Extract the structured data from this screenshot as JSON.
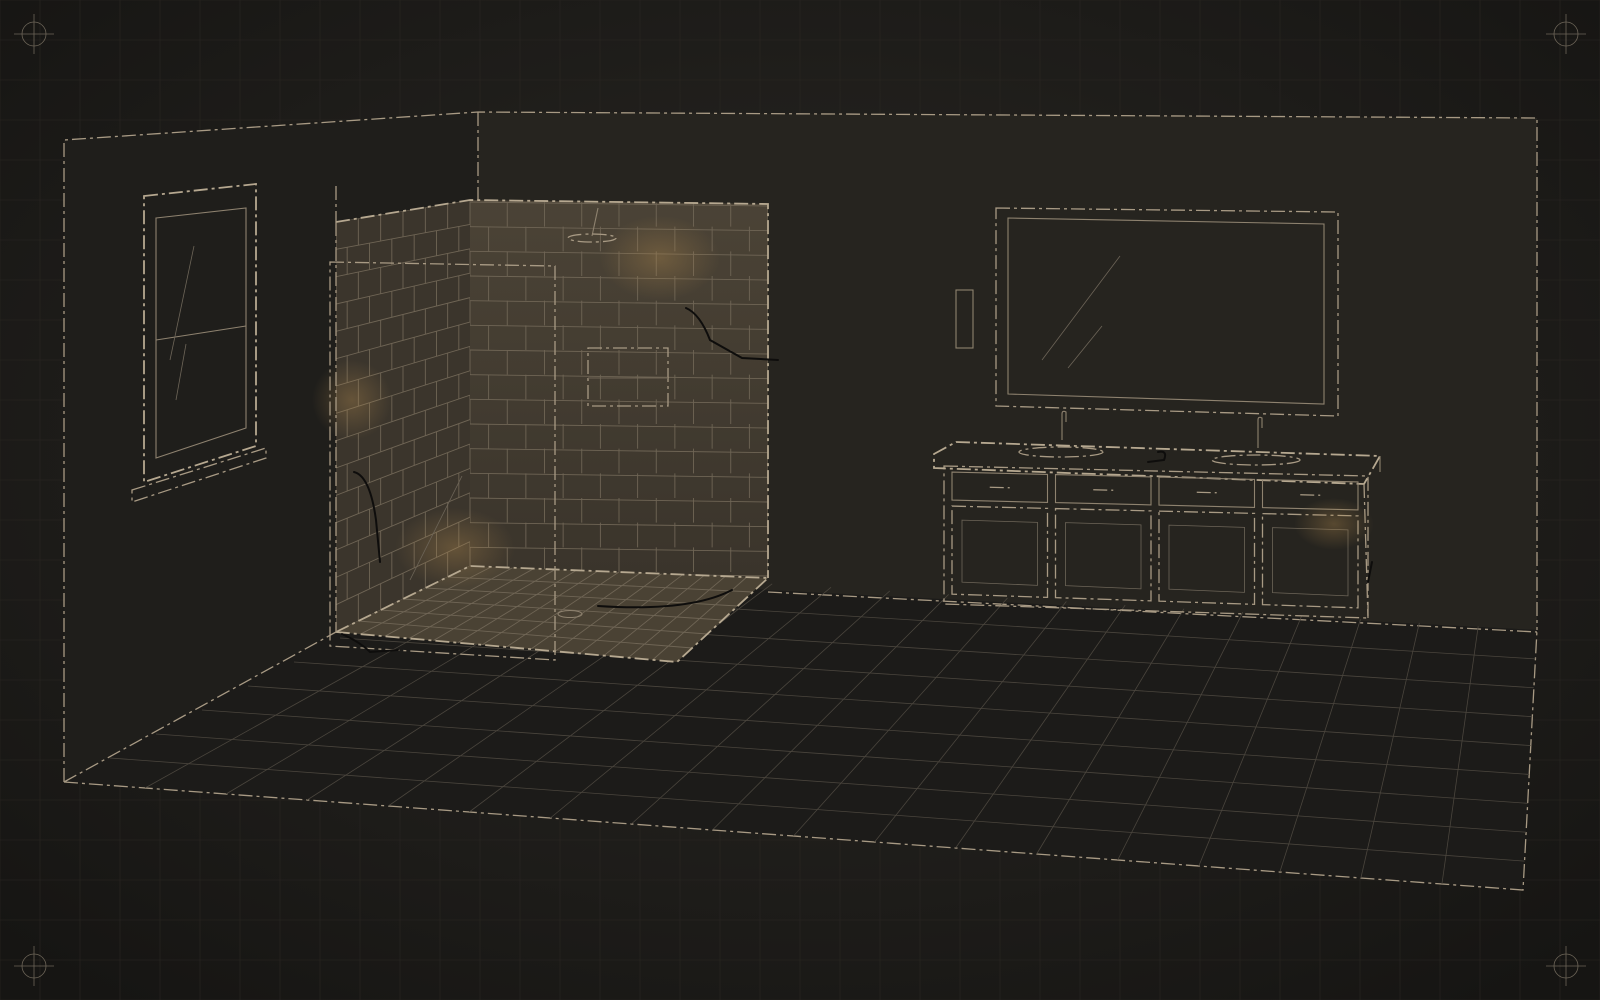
{
  "scene": {
    "kind": "isometric-wireframe-room",
    "palette": {
      "background": "#1b1a18",
      "wall_back": "#25231f",
      "wall_left": "#1f1e1b",
      "floor": "#1d1c1a",
      "line": "#a89a84",
      "tile_fill": "#4a4236",
      "glow": "#b48c50",
      "crack": "#0e0d0c"
    },
    "objects": [
      "room-shell",
      "window",
      "shower-enclosure",
      "shower-head",
      "shower-niche",
      "glass-panel",
      "floor-drain",
      "mirror",
      "light-switch",
      "double-vanity",
      "vanity-sinks",
      "vanity-faucets",
      "floor-tile-grid",
      "corner-registration-marks"
    ],
    "vanity": {
      "drawer_count": 4,
      "door_count": 4,
      "sink_count": 2
    },
    "shower_walls": {
      "tile_rows": 15,
      "tile_columns_back": 8
    }
  }
}
